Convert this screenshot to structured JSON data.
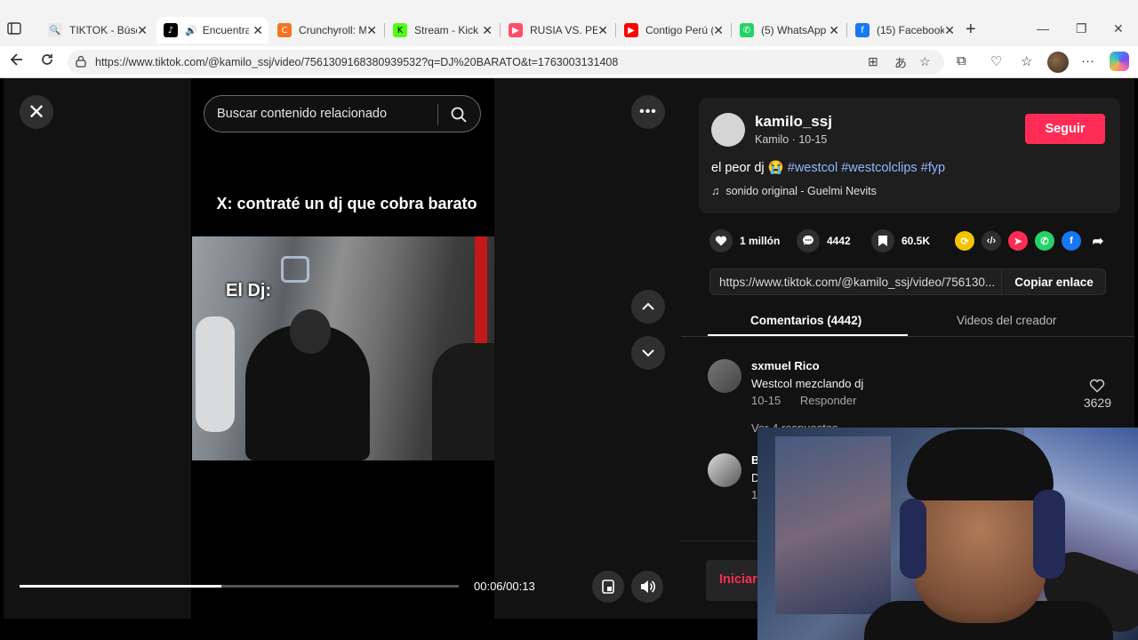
{
  "browser": {
    "tabs": [
      {
        "title": "TIKTOK - Búsqueda",
        "fav": "search",
        "color": "#e8e8e8"
      },
      {
        "title": "Encuentra",
        "fav": "tiktok",
        "color": "#000000",
        "active": true
      },
      {
        "title": "Crunchyroll: Mira",
        "fav": "crunchyroll",
        "color": "#f47521"
      },
      {
        "title": "Stream - Kick",
        "fav": "kick",
        "color": "#53fc18"
      },
      {
        "title": "RUSIA VS. PERÚ",
        "fav": "youtube-red",
        "color": "#ff4d6d"
      },
      {
        "title": "Contigo Perú (U",
        "fav": "youtube",
        "color": "#ff0000"
      },
      {
        "title": "(5) WhatsApp",
        "fav": "whatsapp",
        "color": "#25d366"
      },
      {
        "title": "(15) Facebook",
        "fav": "facebook",
        "color": "#1877f2"
      }
    ],
    "url": "https://www.tiktok.com/@kamilo_ssj/video/7561309168380939532?q=DJ%20BARATO&t=1763003131408"
  },
  "video": {
    "search_placeholder": "Buscar contenido relacionado",
    "caption": "X: contraté un dj que cobra barato",
    "overlay_text": "El Dj:",
    "time": "00:06/00:13",
    "progress": 0.46
  },
  "post": {
    "username": "kamilo_ssj",
    "subline": "Kamilo · 10-15",
    "follow_label": "Seguir",
    "desc_text": "el peor dj 😭",
    "hashtags": [
      "#westcol",
      "#westcolclips",
      "#fyp"
    ],
    "sound": "sonido original - Guelmi Nevits",
    "likes": "1 millón",
    "comments_count": "4442",
    "saves": "60.5K",
    "link": "https://www.tiktok.com/@kamilo_ssj/video/756130...",
    "copy_label": "Copiar enlace"
  },
  "comment_tabs": {
    "comments": "Comentarios (4442)",
    "creator_videos": "Videos del creador"
  },
  "comments": [
    {
      "name": "sxmuel Rico",
      "text": "Westcol mezclando dj",
      "date": "10-15",
      "reply": "Responder",
      "likes": "3629"
    },
    {
      "name": "B",
      "text": "D",
      "date": "1",
      "reply": "",
      "likes": ""
    }
  ],
  "replies_text": "Ver 4 respuestas",
  "login_label": "Iniciar"
}
